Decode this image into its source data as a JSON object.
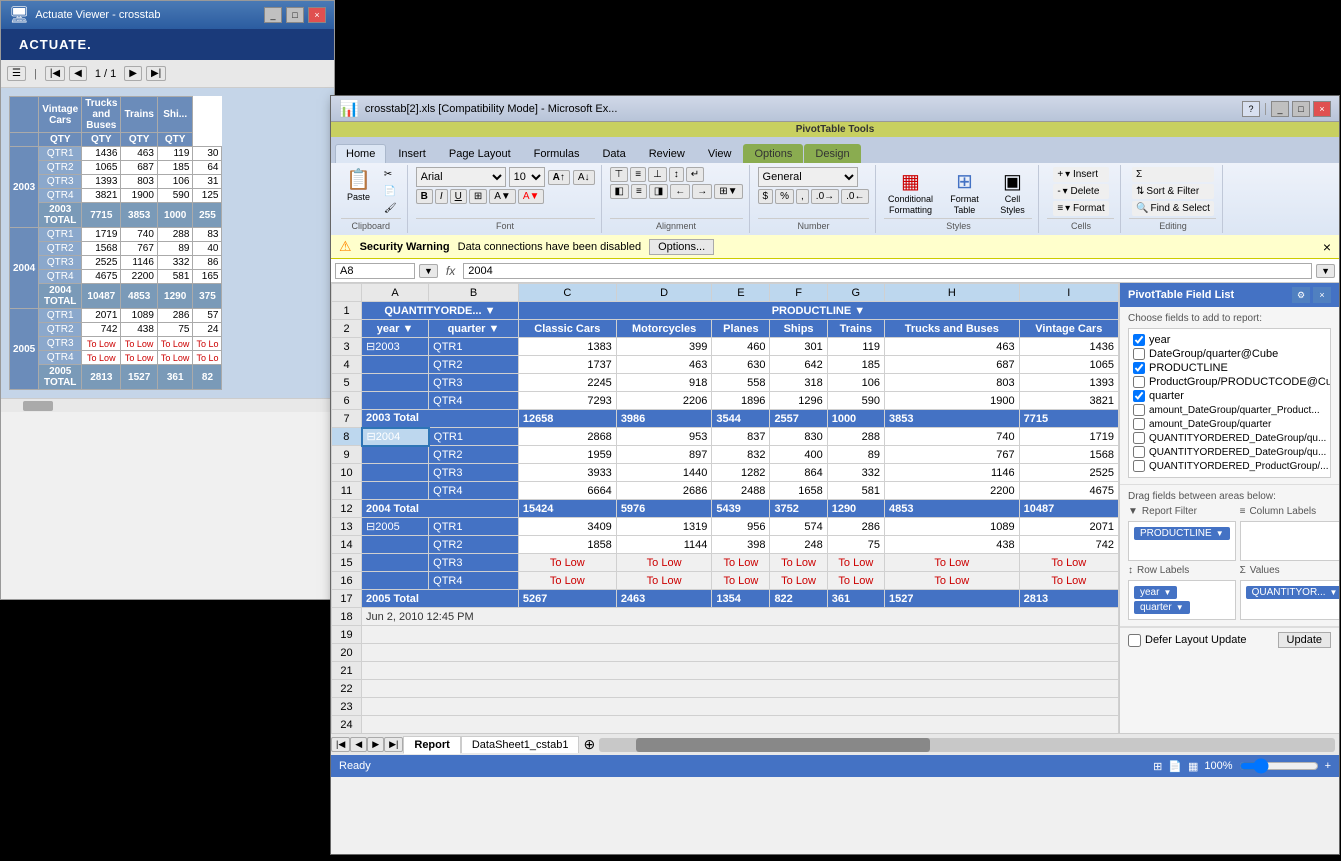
{
  "actuate": {
    "title": "Actuate Viewer - crosstab",
    "logo": "ACTUATE.",
    "page": "1 / 1",
    "table": {
      "headers": [
        "",
        "Vintage Cars",
        "Trucks and Buses",
        "Trains",
        "Shi..."
      ],
      "sub_headers": [
        "",
        "QTY",
        "QTY",
        "QTY",
        "QTY"
      ],
      "rows": [
        {
          "year": "2003",
          "qtr": "QTR1",
          "v": "1436",
          "t": "463",
          "tr": "119",
          "s": "30"
        },
        {
          "year": "",
          "qtr": "QTR2",
          "v": "1065",
          "t": "687",
          "tr": "185",
          "s": "64"
        },
        {
          "year": "",
          "qtr": "QTR3",
          "v": "1393",
          "t": "803",
          "tr": "106",
          "s": "31"
        },
        {
          "year": "",
          "qtr": "QTR4",
          "v": "3821",
          "t": "1900",
          "tr": "590",
          "s": "125"
        },
        {
          "year": "",
          "qtr": "2003 TOTAL",
          "v": "7715",
          "t": "3853",
          "tr": "1000",
          "s": "255",
          "is_total": true
        },
        {
          "year": "2004",
          "qtr": "QTR1",
          "v": "1719",
          "t": "740",
          "tr": "288",
          "s": "83"
        },
        {
          "year": "",
          "qtr": "QTR2",
          "v": "1568",
          "t": "767",
          "tr": "89",
          "s": "40"
        },
        {
          "year": "",
          "qtr": "QTR3",
          "v": "2525",
          "t": "1146",
          "tr": "332",
          "s": "86"
        },
        {
          "year": "",
          "qtr": "QTR4",
          "v": "4675",
          "t": "2200",
          "tr": "581",
          "s": "165"
        },
        {
          "year": "",
          "qtr": "2004 TOTAL",
          "v": "10487",
          "t": "4853",
          "tr": "1290",
          "s": "375",
          "is_total": true
        },
        {
          "year": "2005",
          "qtr": "QTR1",
          "v": "2071",
          "t": "1089",
          "tr": "286",
          "s": "57"
        },
        {
          "year": "",
          "qtr": "QTR2",
          "v": "742",
          "t": "438",
          "tr": "75",
          "s": "24"
        },
        {
          "year": "",
          "qtr": "QTR3",
          "v": "To Low",
          "t": "To Low",
          "tr": "To Low",
          "s": "To Lo",
          "tolow": true
        },
        {
          "year": "",
          "qtr": "QTR4",
          "v": "To Low",
          "t": "To Low",
          "tr": "To Low",
          "s": "To Lo",
          "tolow": true
        },
        {
          "year": "",
          "qtr": "2005 TOTAL",
          "v": "2813",
          "t": "1527",
          "tr": "361",
          "s": "82",
          "is_total": true
        }
      ]
    }
  },
  "excel": {
    "title": "crosstab[2].xls [Compatibility Mode] - Microsoft Ex...",
    "pivot_tools": "PivotTable Tools",
    "tabs": [
      "Home",
      "Insert",
      "Page Layout",
      "Formulas",
      "Data",
      "Review",
      "View",
      "Options",
      "Design"
    ],
    "active_tab": "Home",
    "font": "Arial",
    "size": "10",
    "number_format": "General",
    "cell_ref": "A8",
    "formula_value": "2004",
    "security_warning": "Security Warning",
    "security_msg": "Data connections have been disabled",
    "security_btn": "Options...",
    "col_headers": [
      "",
      "A",
      "B",
      "C",
      "D",
      "E",
      "F",
      "G",
      "H",
      "I"
    ],
    "rows": {
      "r1_headers": [
        "QUANTITYORDE...",
        "PRODUCTLINE ▼"
      ],
      "r2": [
        "year ▼",
        "quarter ▼",
        "Classic Cars",
        "Motorcycles",
        "Planes",
        "Ships",
        "Trains",
        "Trucks and Buses",
        "Vintage Cars"
      ],
      "r3": [
        "▣2003",
        "QTR1",
        "1383",
        "399",
        "460",
        "301",
        "119",
        "463",
        "1436"
      ],
      "r4": [
        "",
        "QTR2",
        "1737",
        "463",
        "630",
        "642",
        "185",
        "687",
        "1065"
      ],
      "r5": [
        "",
        "QTR3",
        "2245",
        "918",
        "558",
        "318",
        "106",
        "803",
        "1393"
      ],
      "r6": [
        "",
        "QTR4",
        "7293",
        "2206",
        "1896",
        "1296",
        "590",
        "1900",
        "3821"
      ],
      "r7_total": [
        "2003 Total",
        "",
        "12658",
        "3986",
        "3544",
        "2557",
        "1000",
        "3853",
        "7715"
      ],
      "r8": [
        "▣2004",
        "QTR1",
        "2868",
        "953",
        "837",
        "830",
        "288",
        "740",
        "1719"
      ],
      "r9": [
        "",
        "QTR2",
        "1959",
        "897",
        "832",
        "400",
        "89",
        "767",
        "1568"
      ],
      "r10": [
        "",
        "QTR3",
        "3933",
        "1440",
        "1282",
        "864",
        "332",
        "1146",
        "2525"
      ],
      "r11": [
        "",
        "QTR4",
        "6664",
        "2686",
        "2488",
        "1658",
        "581",
        "2200",
        "4675"
      ],
      "r12_total": [
        "2004 Total",
        "",
        "15424",
        "5976",
        "5439",
        "3752",
        "1290",
        "4853",
        "10487"
      ],
      "r13": [
        "▣2005",
        "QTR1",
        "3409",
        "1319",
        "956",
        "574",
        "286",
        "1089",
        "2071"
      ],
      "r14": [
        "",
        "QTR2",
        "1858",
        "1144",
        "398",
        "248",
        "75",
        "438",
        "742"
      ],
      "r15": [
        "",
        "QTR3",
        "To Low",
        "To Low",
        "To Low",
        "To Low",
        "To Low",
        "To Low",
        "To Low"
      ],
      "r16": [
        "",
        "QTR4",
        "To Low",
        "To Low",
        "To Low",
        "To Low",
        "To Low",
        "To Low",
        "To Low"
      ],
      "r17_total": [
        "2005 Total",
        "",
        "5267",
        "2463",
        "1354",
        "822",
        "361",
        "1527",
        "2813"
      ],
      "r18_date": "Jun 2, 2010 12:45 PM"
    },
    "sheet_tabs": [
      "Report",
      "DataSheet1_cstab1"
    ],
    "active_sheet": "Report",
    "status": "Ready",
    "zoom": "100%",
    "pivot_panel": {
      "title": "PivotTable Field List",
      "choose_label": "Choose fields to add to report:",
      "fields": [
        {
          "name": "year",
          "checked": true
        },
        {
          "name": "DateGroup/quarter@Cube",
          "checked": false
        },
        {
          "name": "PRODUCTLINE",
          "checked": true
        },
        {
          "name": "ProductGroup/PRODUCTCODE@Cube",
          "checked": false
        },
        {
          "name": "quarter",
          "checked": true
        },
        {
          "name": "amount_DateGroup/quarter_Product...",
          "checked": false
        },
        {
          "name": "amount_DateGroup/quarter",
          "checked": false
        },
        {
          "name": "QUANTITYORDERED_DateGroup/qu...",
          "checked": false
        },
        {
          "name": "QUANTITYORDERED_DateGroup/qu...",
          "checked": false
        },
        {
          "name": "QUANTITYORDERED_ProductGroup/...",
          "checked": false
        }
      ],
      "drag_label": "Drag fields between areas below:",
      "report_filter_label": "Report Filter",
      "column_labels_label": "Column Labels",
      "row_labels_label": "Row Labels",
      "values_label": "Values",
      "report_filter_tag": "PRODUCTLINE",
      "row_labels_tags": [
        "year",
        "quarter"
      ],
      "values_tag": "QUANTITYOR...",
      "defer_label": "Defer Layout Update",
      "update_btn": "Update"
    },
    "ribbon": {
      "paste_label": "Paste",
      "clipboard_label": "Clipboard",
      "font_label": "Font",
      "alignment_label": "Alignment",
      "number_label": "Number",
      "styles_label": "Styles",
      "cells_label": "Cells",
      "editing_label": "Editing",
      "insert_label": "▾ Insert",
      "delete_label": "▾ Delete",
      "format_label": "▾ Format",
      "cond_format_label": "Conditional Formatting",
      "format_table_label": "Format Table",
      "cell_styles_label": "Cell Styles",
      "sort_filter_label": "Sort & Filter",
      "find_select_label": "Find & Select"
    }
  }
}
